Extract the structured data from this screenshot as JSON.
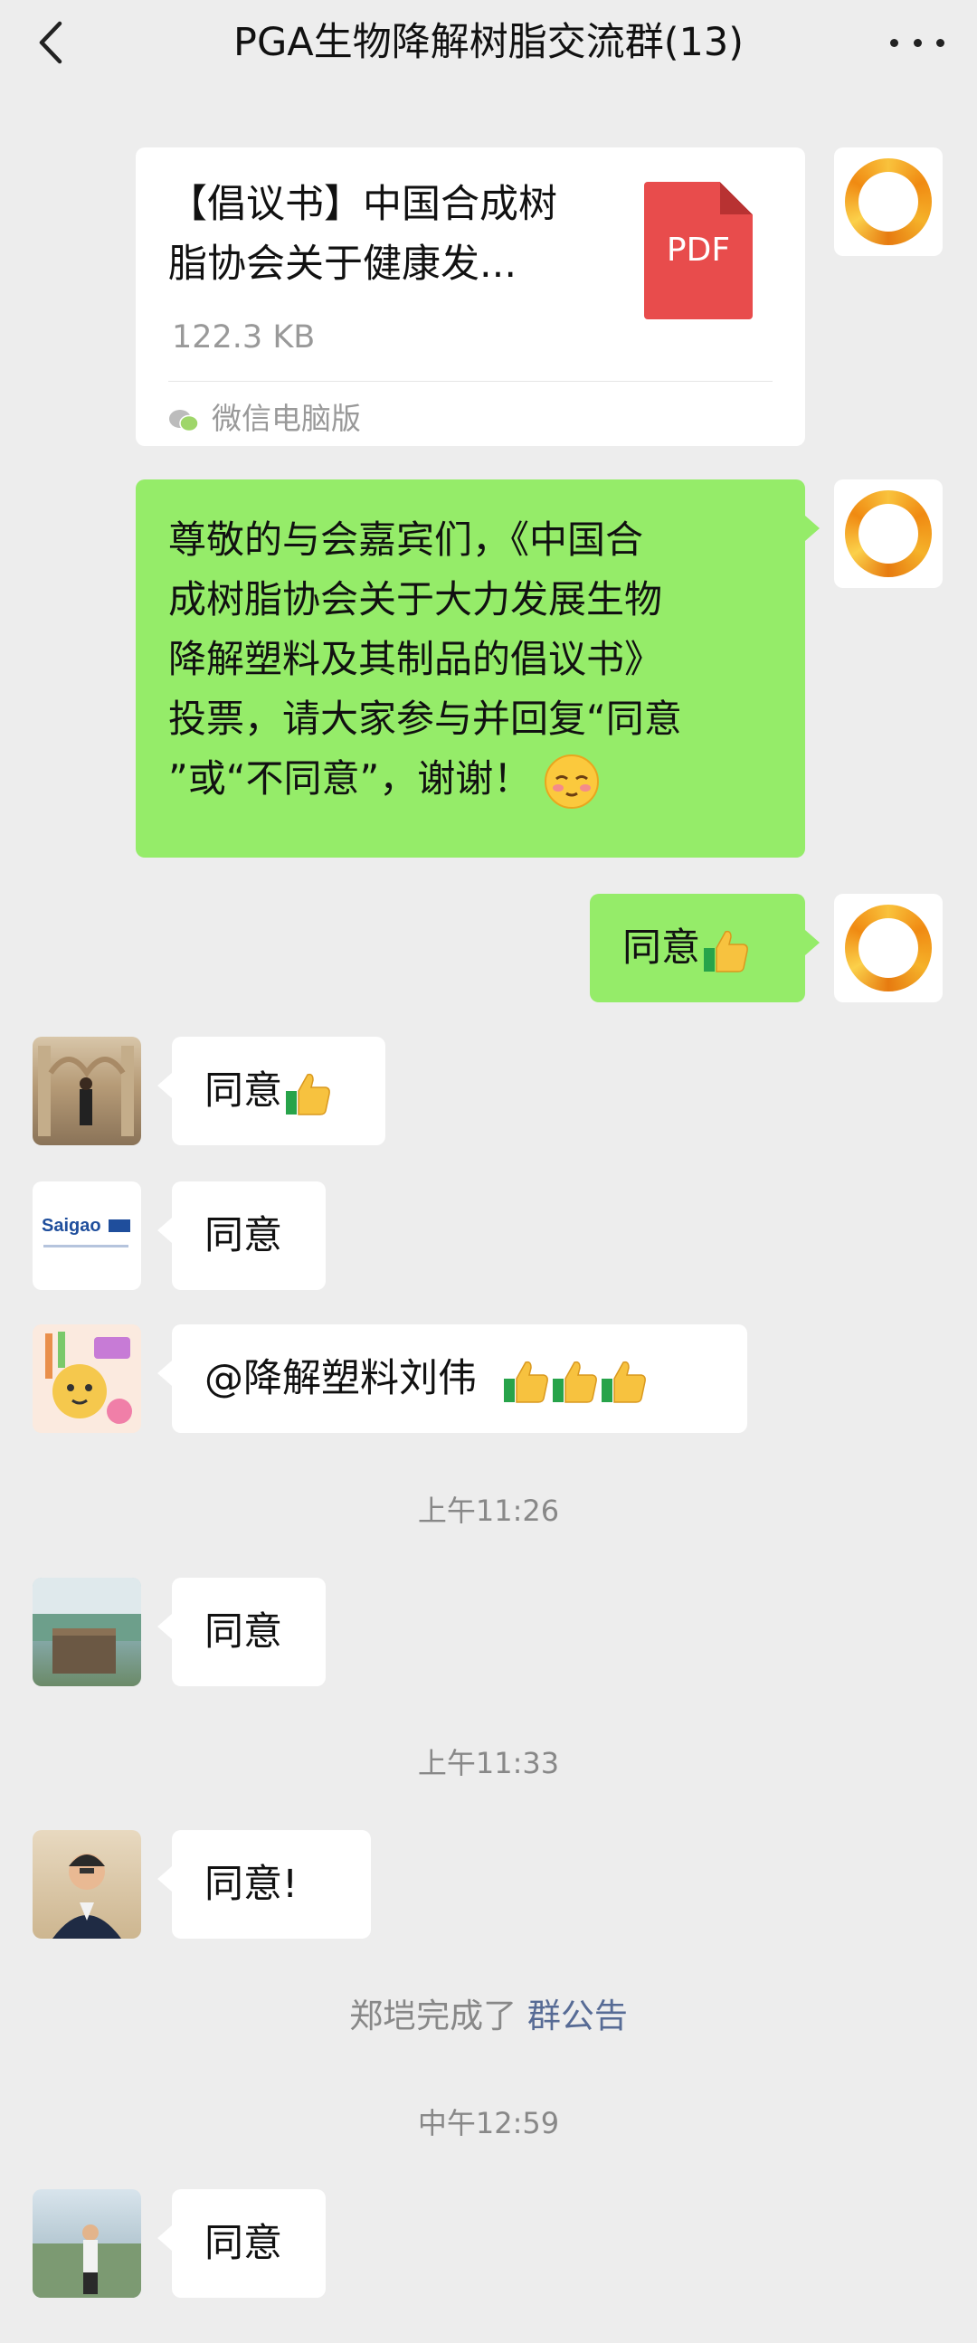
{
  "header": {
    "title": "PGA生物降解树脂交流群(13)",
    "back_icon": "chevron-left-icon",
    "more_icon": "more-dots-icon"
  },
  "messages": {
    "file": {
      "name": "【倡议书】中国合成树脂协会关于健康发...",
      "name_line1": "【倡议书】中国合成树",
      "name_line2": "脂协会关于健康发...",
      "size": "122.3 KB",
      "type": "PDF",
      "source": "微信电脑版"
    },
    "proposal": {
      "line1": "尊敬的与会嘉宾们，《中国合",
      "line2": "成树脂协会关于大力发展生物",
      "line3": "降解塑料及其制品的倡议书》",
      "line4": "投票，请大家参与并回复“同意",
      "line5": "”或“不同意”，谢谢！"
    },
    "me_agree": "同意",
    "m1": "同意",
    "m2": "同意",
    "m3": "@降解塑料刘伟",
    "m4": "同意",
    "m5": "同意!",
    "m6": "同意",
    "saigao_logo": "Saigao"
  },
  "timestamps": {
    "t1": "上午11:26",
    "t2": "上午11:33",
    "t3": "中午12:59"
  },
  "notice": {
    "prefix": "郑垲完成了 ",
    "link": "群公告"
  },
  "colors": {
    "background": "#ededed",
    "my_bubble": "#95ec69",
    "other_bubble": "#ffffff",
    "link": "#576b95",
    "pdf_red": "#e84c4c"
  }
}
